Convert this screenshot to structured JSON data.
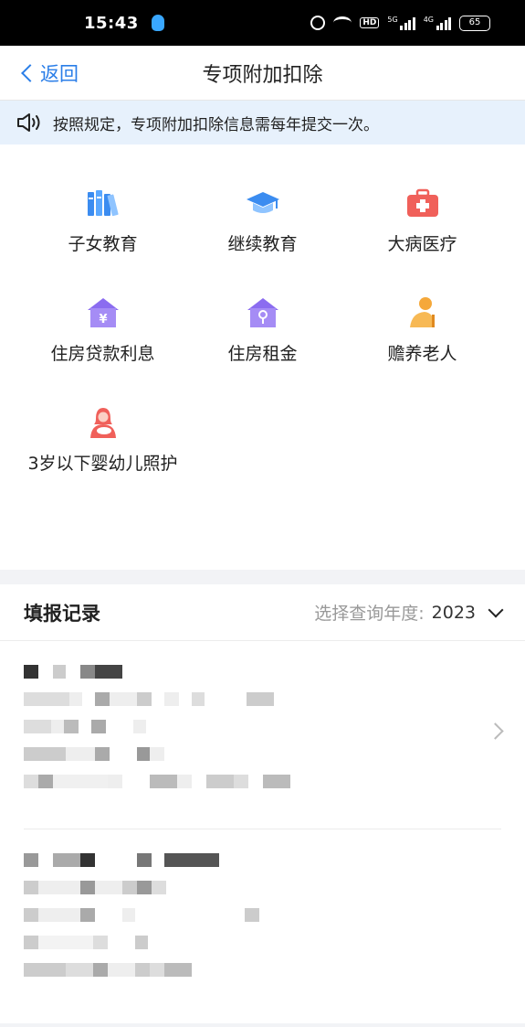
{
  "status": {
    "time": "15:43",
    "battery": "65",
    "hd": "HD",
    "sig1": "5G",
    "sig2": "4G"
  },
  "nav": {
    "back_label": "返回",
    "title": "专项附加扣除"
  },
  "notice": {
    "text": "按照规定，专项附加扣除信息需每年提交一次。"
  },
  "categories": [
    {
      "label": "子女教育",
      "icon": "books-icon"
    },
    {
      "label": "继续教育",
      "icon": "graduation-cap-icon"
    },
    {
      "label": "大病医疗",
      "icon": "medical-kit-icon"
    },
    {
      "label": "住房贷款利息",
      "icon": "house-yuan-icon"
    },
    {
      "label": "住房租金",
      "icon": "house-key-icon"
    },
    {
      "label": "赡养老人",
      "icon": "elderly-icon"
    },
    {
      "label": "3岁以下婴幼儿照护",
      "icon": "mother-baby-icon"
    }
  ],
  "records": {
    "title": "填报记录",
    "year_label": "选择查询年度:",
    "year_value": "2023"
  },
  "colors": {
    "accent": "#2a7ee8",
    "notice_bg": "#e7f1fc",
    "icon_purple": "#8b6cf0",
    "icon_red": "#f0605a",
    "icon_orange": "#f5a83a"
  }
}
